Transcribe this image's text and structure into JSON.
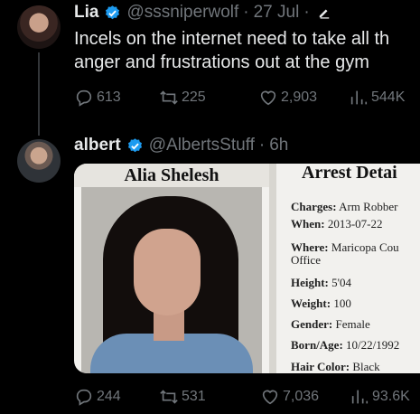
{
  "tweet1": {
    "name": "Lia",
    "handle": "@sssniperwolf",
    "time": "27 Jul",
    "text_line1": "Incels on the internet need to take all th",
    "text_line2": "anger and frustrations out at the gym",
    "replies": "613",
    "retweets": "225",
    "likes": "2,903",
    "views": "544K"
  },
  "tweet2": {
    "name": "albert",
    "handle": "@AlbertsStuff",
    "time": "6h",
    "replies": "244",
    "retweets": "531",
    "likes": "7,036",
    "views": "93.6K"
  },
  "mugshot": {
    "name": "Alia Shelesh",
    "title": "Arrest Detai",
    "charges_label": "Charges:",
    "charges": "Arm Robber",
    "when_label": "When:",
    "when": "2013-07-22",
    "where_label": "Where:",
    "where": "Maricopa Cou",
    "where2": "Office",
    "height_label": "Height:",
    "height": "5'04",
    "weight_label": "Weight:",
    "weight": "100",
    "gender_label": "Gender:",
    "gender": "Female",
    "born_label": "Born/Age:",
    "born": "10/22/1992",
    "hair_label": "Hair Color:",
    "hair": "Black"
  },
  "colors": {
    "verified": "#1d9bf0",
    "muted": "#71767b",
    "text": "#e7e9ea"
  }
}
